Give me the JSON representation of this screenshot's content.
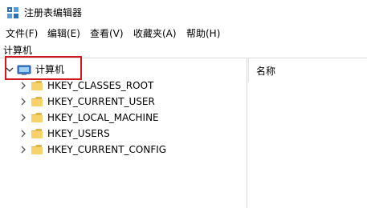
{
  "window": {
    "title": "注册表编辑器"
  },
  "menu": {
    "items": [
      "文件(F)",
      "编辑(E)",
      "查看(V)",
      "收藏夹(A)",
      "帮助(H)"
    ]
  },
  "address": {
    "path": "计算机"
  },
  "tree": {
    "root": {
      "label": "计算机",
      "expanded": true,
      "selected": true
    },
    "children": [
      {
        "label": "HKEY_CLASSES_ROOT"
      },
      {
        "label": "HKEY_CURRENT_USER"
      },
      {
        "label": "HKEY_LOCAL_MACHINE"
      },
      {
        "label": "HKEY_USERS"
      },
      {
        "label": "HKEY_CURRENT_CONFIG"
      }
    ]
  },
  "list": {
    "column_name": "名称"
  },
  "colors": {
    "highlight": "#d0191c",
    "folder": "#f7d26a",
    "folder_dark": "#e5b646",
    "accent": "#3a7bd5"
  },
  "icons": {
    "app": "registry-editor-icon",
    "computer": "computer-icon",
    "folder": "folder-icon"
  }
}
